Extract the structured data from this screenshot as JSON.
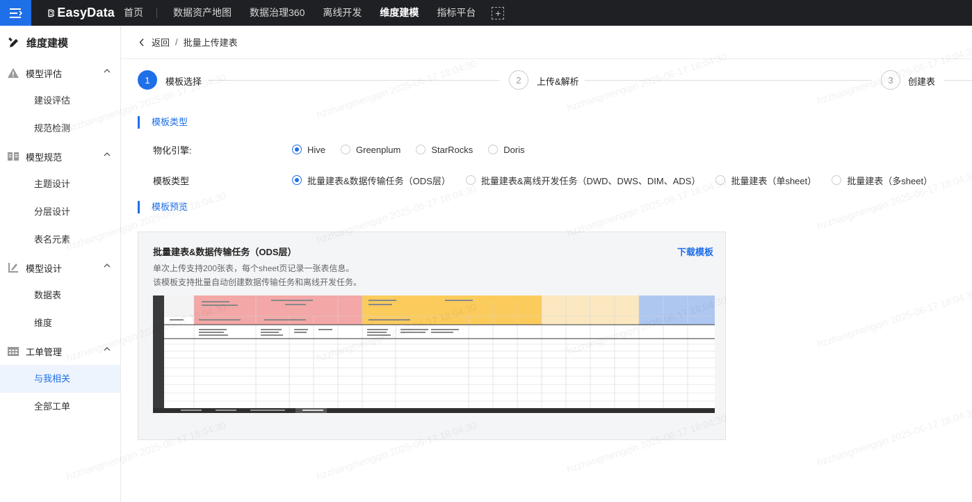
{
  "topbar": {
    "logo_text": "EasyData",
    "nav": [
      {
        "label": "首页",
        "active": false
      },
      {
        "label": "数据资产地图",
        "active": false
      },
      {
        "label": "数据治理360",
        "active": false
      },
      {
        "label": "离线开发",
        "active": false
      },
      {
        "label": "维度建模",
        "active": true
      },
      {
        "label": "指标平台",
        "active": false
      }
    ],
    "accent": "#1e6fe8"
  },
  "sidebar": {
    "title": "维度建模",
    "groups": [
      {
        "title": "模型评估",
        "icon": "warning-triangle-icon",
        "items": [
          {
            "label": "建设评估"
          },
          {
            "label": "规范检测"
          }
        ]
      },
      {
        "title": "模型规范",
        "icon": "book-icon",
        "items": [
          {
            "label": "主题设计"
          },
          {
            "label": "分层设计"
          },
          {
            "label": "表名元素"
          }
        ]
      },
      {
        "title": "模型设计",
        "icon": "design-icon",
        "items": [
          {
            "label": "数据表"
          },
          {
            "label": "维度"
          }
        ]
      },
      {
        "title": "工单管理",
        "icon": "calendar-icon",
        "items": [
          {
            "label": "与我相关",
            "active": true
          },
          {
            "label": "全部工单"
          }
        ]
      }
    ]
  },
  "breadcrumb": {
    "back": "返回",
    "separator": "/",
    "current": "批量上传建表"
  },
  "steps": [
    {
      "number": "1",
      "label": "模板选择",
      "status": "active"
    },
    {
      "number": "2",
      "label": "上传&解析",
      "status": "todo"
    },
    {
      "number": "3",
      "label": "创建表",
      "status": "todo"
    }
  ],
  "section_template_type": "模板类型",
  "engine": {
    "label": "物化引擎:",
    "options": [
      {
        "label": "Hive",
        "checked": true
      },
      {
        "label": "Greenplum",
        "checked": false
      },
      {
        "label": "StarRocks",
        "checked": false
      },
      {
        "label": "Doris",
        "checked": false
      }
    ]
  },
  "template_type": {
    "label": "模板类型",
    "options": [
      {
        "label": "批量建表&数据传输任务（ODS层）",
        "checked": true
      },
      {
        "label": "批量建表&离线开发任务（DWD、DWS、DIM、ADS）",
        "checked": false
      },
      {
        "label": "批量建表（单sheet）",
        "checked": false
      },
      {
        "label": "批量建表（多sheet）",
        "checked": false
      }
    ]
  },
  "section_preview": "模板预览",
  "preview": {
    "title": "批量建表&数据传输任务（ODS层）",
    "download": "下载模板",
    "desc1": "单次上传支持200张表，每个sheet页记录一张表信息。",
    "desc2": "该模板支持批量自动创建数据传输任务和离线开发任务。"
  },
  "watermark": "hzzhangmengqin 2025-06-17 18:04:30"
}
